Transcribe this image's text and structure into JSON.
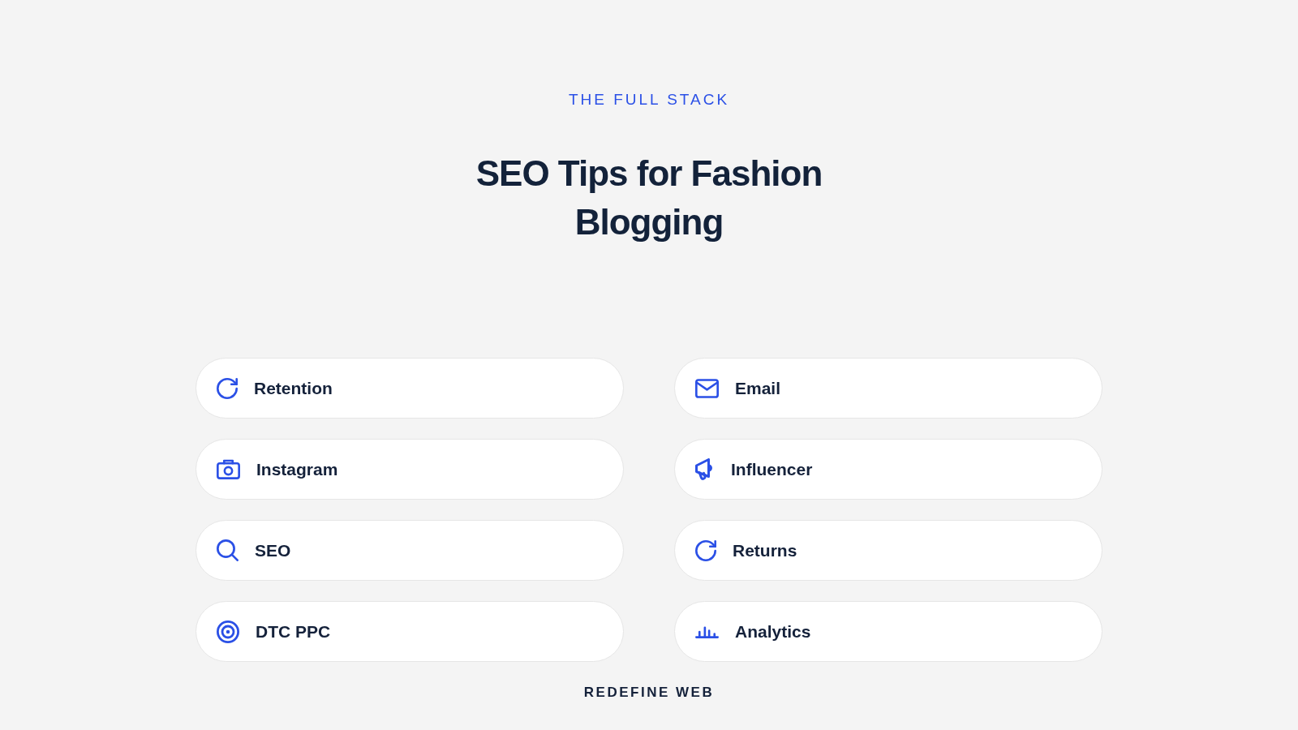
{
  "eyebrow": "THE FULL STACK",
  "title": "SEO Tips for Fashion Blogging",
  "topics": [
    {
      "label": "Retention"
    },
    {
      "label": "Email"
    },
    {
      "label": "Instagram"
    },
    {
      "label": "Influencer"
    },
    {
      "label": "SEO"
    },
    {
      "label": "Returns"
    },
    {
      "label": "DTC PPC"
    },
    {
      "label": "Analytics"
    }
  ],
  "footer": "REDEFINE WEB"
}
